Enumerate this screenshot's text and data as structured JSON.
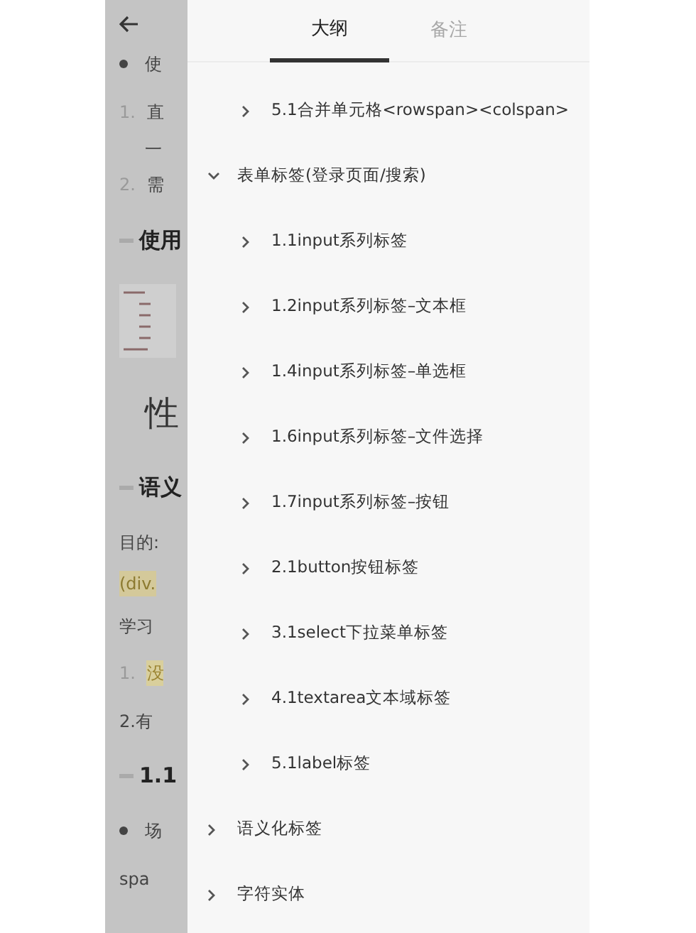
{
  "document": {
    "lines": [
      {
        "kind": "back"
      },
      {
        "kind": "bullet",
        "text": "使"
      },
      {
        "kind": "numbered",
        "number": "1.",
        "text": "直"
      },
      {
        "kind": "plain",
        "text": "一"
      },
      {
        "kind": "numbered",
        "number": "2.",
        "text": "需"
      },
      {
        "kind": "heading",
        "text": "使用"
      },
      {
        "kind": "code"
      },
      {
        "kind": "big",
        "text": "性"
      },
      {
        "kind": "heading",
        "text": "语义"
      },
      {
        "kind": "plain",
        "text": "目的:"
      },
      {
        "kind": "highlight",
        "text": "(div."
      },
      {
        "kind": "plain",
        "text": "学习"
      },
      {
        "kind": "numbered_highlight",
        "number": "1.",
        "text": "没"
      },
      {
        "kind": "plain",
        "text": "2.有"
      },
      {
        "kind": "heading",
        "text": "1.1"
      },
      {
        "kind": "bullet",
        "text": "场"
      },
      {
        "kind": "plain",
        "text": "spa"
      }
    ]
  },
  "tabs": [
    {
      "label": "大纲",
      "selected": true
    },
    {
      "label": "备注",
      "selected": false
    }
  ],
  "outline": {
    "continued": [
      {
        "label": "5.1合并单元格<rowspan><colspan>",
        "expanded": false
      }
    ],
    "items": [
      {
        "label": "表单标签(登录页面/搜索)",
        "expanded": true,
        "children": [
          {
            "label": "1.1input系列标签",
            "expanded": false
          },
          {
            "label": "1.2input系列标签–文本框",
            "expanded": false
          },
          {
            "label": "1.4input系列标签–单选框",
            "expanded": false
          },
          {
            "label": "1.6input系列标签–文件选择",
            "expanded": false
          },
          {
            "label": "1.7input系列标签–按钮",
            "expanded": false
          },
          {
            "label": "2.1button按钮标签",
            "expanded": false
          },
          {
            "label": "3.1select下拉菜单标签",
            "expanded": false
          },
          {
            "label": "4.1textarea文本域标签",
            "expanded": false
          },
          {
            "label": "5.1label标签",
            "expanded": false
          }
        ]
      },
      {
        "label": "语义化标签",
        "expanded": false
      },
      {
        "label": "字符实体",
        "expanded": false
      }
    ]
  }
}
